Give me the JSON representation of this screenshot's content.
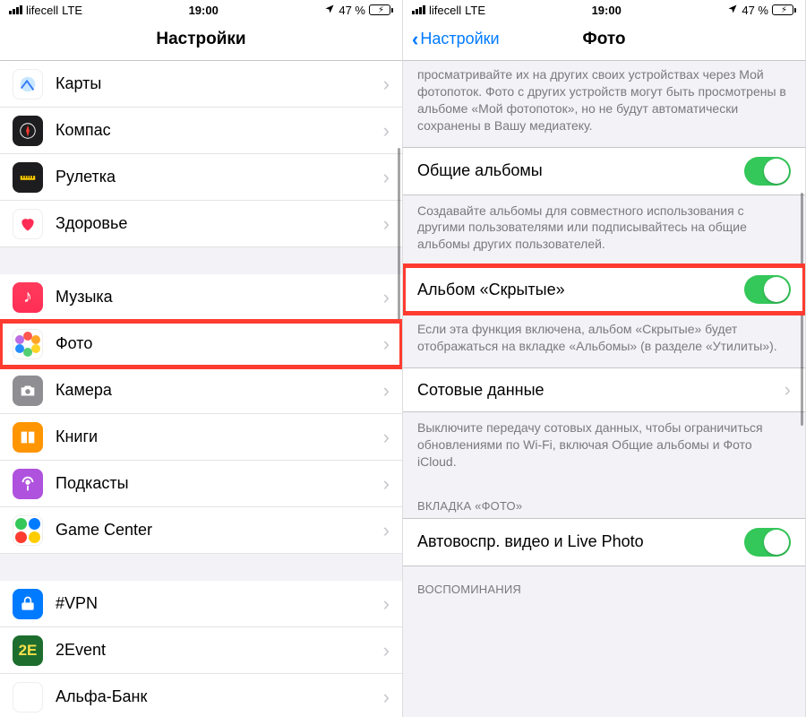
{
  "status": {
    "carrier": "lifecell",
    "network": "LTE",
    "time": "19:00",
    "battery_text": "47 %"
  },
  "left": {
    "title": "Настройки",
    "groups": [
      {
        "items": [
          {
            "label": "Карты",
            "icon": "maps-icon"
          },
          {
            "label": "Компас",
            "icon": "compass-icon"
          },
          {
            "label": "Рулетка",
            "icon": "measure-icon"
          },
          {
            "label": "Здоровье",
            "icon": "health-icon"
          }
        ]
      },
      {
        "items": [
          {
            "label": "Музыка",
            "icon": "music-icon"
          },
          {
            "label": "Фото",
            "icon": "photos-icon",
            "highlighted": true
          },
          {
            "label": "Камера",
            "icon": "camera-icon"
          },
          {
            "label": "Книги",
            "icon": "books-icon"
          },
          {
            "label": "Подкасты",
            "icon": "podcasts-icon"
          },
          {
            "label": "Game Center",
            "icon": "gamecenter-icon"
          }
        ]
      },
      {
        "items": [
          {
            "label": "#VPN",
            "icon": "vpn-icon"
          },
          {
            "label": "2Event",
            "icon": "twoevent-icon"
          },
          {
            "label": "Альфа-Банк",
            "icon": "alfabank-icon"
          }
        ]
      }
    ]
  },
  "right": {
    "back_label": "Настройки",
    "title": "Фото",
    "intro_text": "просматривайте их на других своих устройствах через Мой фотопоток. Фото с других устройств могут быть просмотрены в альбоме «Мой фотопоток», но не будут автоматически сохранены в Вашу медиатеку.",
    "shared_albums": {
      "label": "Общие альбомы",
      "on": true,
      "footer": "Создавайте альбомы для совместного использования с другими пользователями или подписывайтесь на общие альбомы других пользователей."
    },
    "hidden_album": {
      "label": "Альбом «Скрытые»",
      "on": true,
      "highlighted": true,
      "footer": "Если эта функция включена, альбом «Скрытые» будет отображаться на вкладке «Альбомы» (в разделе «Утилиты»)."
    },
    "cellular": {
      "label": "Сотовые данные",
      "footer": "Выключите передачу сотовых данных, чтобы ограничиться обновлениями по Wi‑Fi, включая Общие альбомы и Фото iCloud."
    },
    "photos_tab_header": "ВКЛАДКА «ФОТО»",
    "autoplay": {
      "label": "Автовоспр. видео и Live Photo",
      "on": true
    },
    "memories_header": "ВОСПОМИНАНИЯ"
  }
}
